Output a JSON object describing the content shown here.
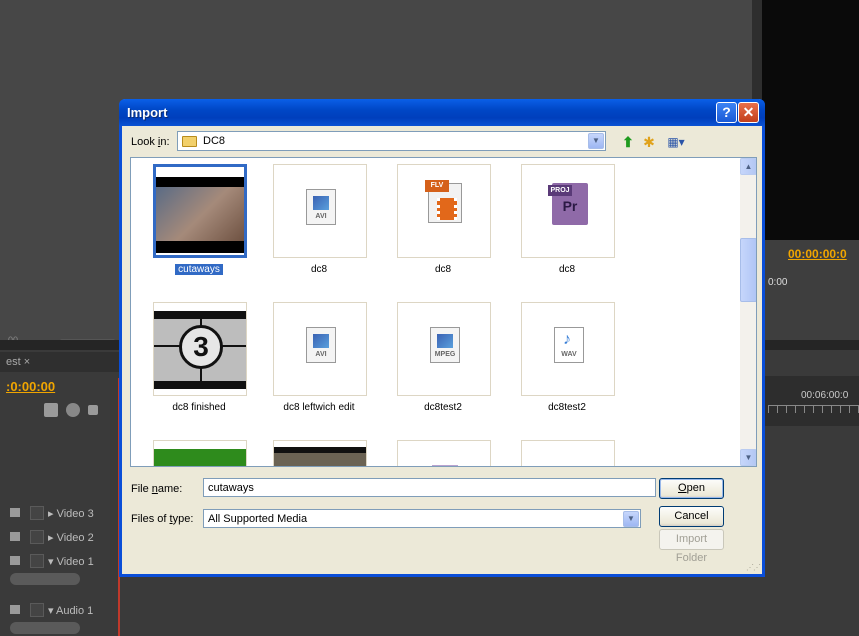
{
  "background": {
    "panel_tab": "est",
    "timecode_left": ":0:00:00",
    "timecode_right": "00:00:00:0",
    "timecode_small": "0:00",
    "timecode_timeline": "00:06:00:0",
    "zoom_label": "00",
    "tracks": [
      {
        "label": "Video 3",
        "expanded": false
      },
      {
        "label": "Video 2",
        "expanded": false
      },
      {
        "label": "Video 1",
        "expanded": true
      },
      {
        "label": "Audio 1",
        "expanded": true
      }
    ]
  },
  "dialog": {
    "title": "Import",
    "help_label": "?",
    "close_label": "✕",
    "look_in_label_pre": "Look ",
    "look_in_label_key": "i",
    "look_in_label_post": "n:",
    "look_in_value": "DC8",
    "files": [
      {
        "name": "cutaways",
        "kind": "video",
        "selected": true
      },
      {
        "name": "dc8",
        "kind": "avi"
      },
      {
        "name": "dc8",
        "kind": "flv"
      },
      {
        "name": "dc8",
        "kind": "proj"
      },
      {
        "name": "dc8 finished",
        "kind": "countdown"
      },
      {
        "name": "dc8 leftwich edit",
        "kind": "avi"
      },
      {
        "name": "dc8test2",
        "kind": "mpeg"
      },
      {
        "name": "dc8test2",
        "kind": "wav"
      }
    ],
    "file_ext": {
      "avi": "AVI",
      "flv": "FLV",
      "proj": "PROJ",
      "mpeg": "MPEG",
      "wav": "WAV",
      "pr": "Pr",
      "countdown_digit": "3"
    },
    "file_name_label_pre": "File ",
    "file_name_label_key": "n",
    "file_name_label_post": "ame:",
    "file_name_value": "cutaways",
    "files_of_type_label_pre": "Files of ",
    "files_of_type_label_key": "t",
    "files_of_type_label_post": "ype:",
    "files_of_type_value": "All Supported Media",
    "open_label_key": "O",
    "open_label_post": "pen",
    "cancel_label": "Cancel",
    "import_folder_label": "Import Folder"
  }
}
